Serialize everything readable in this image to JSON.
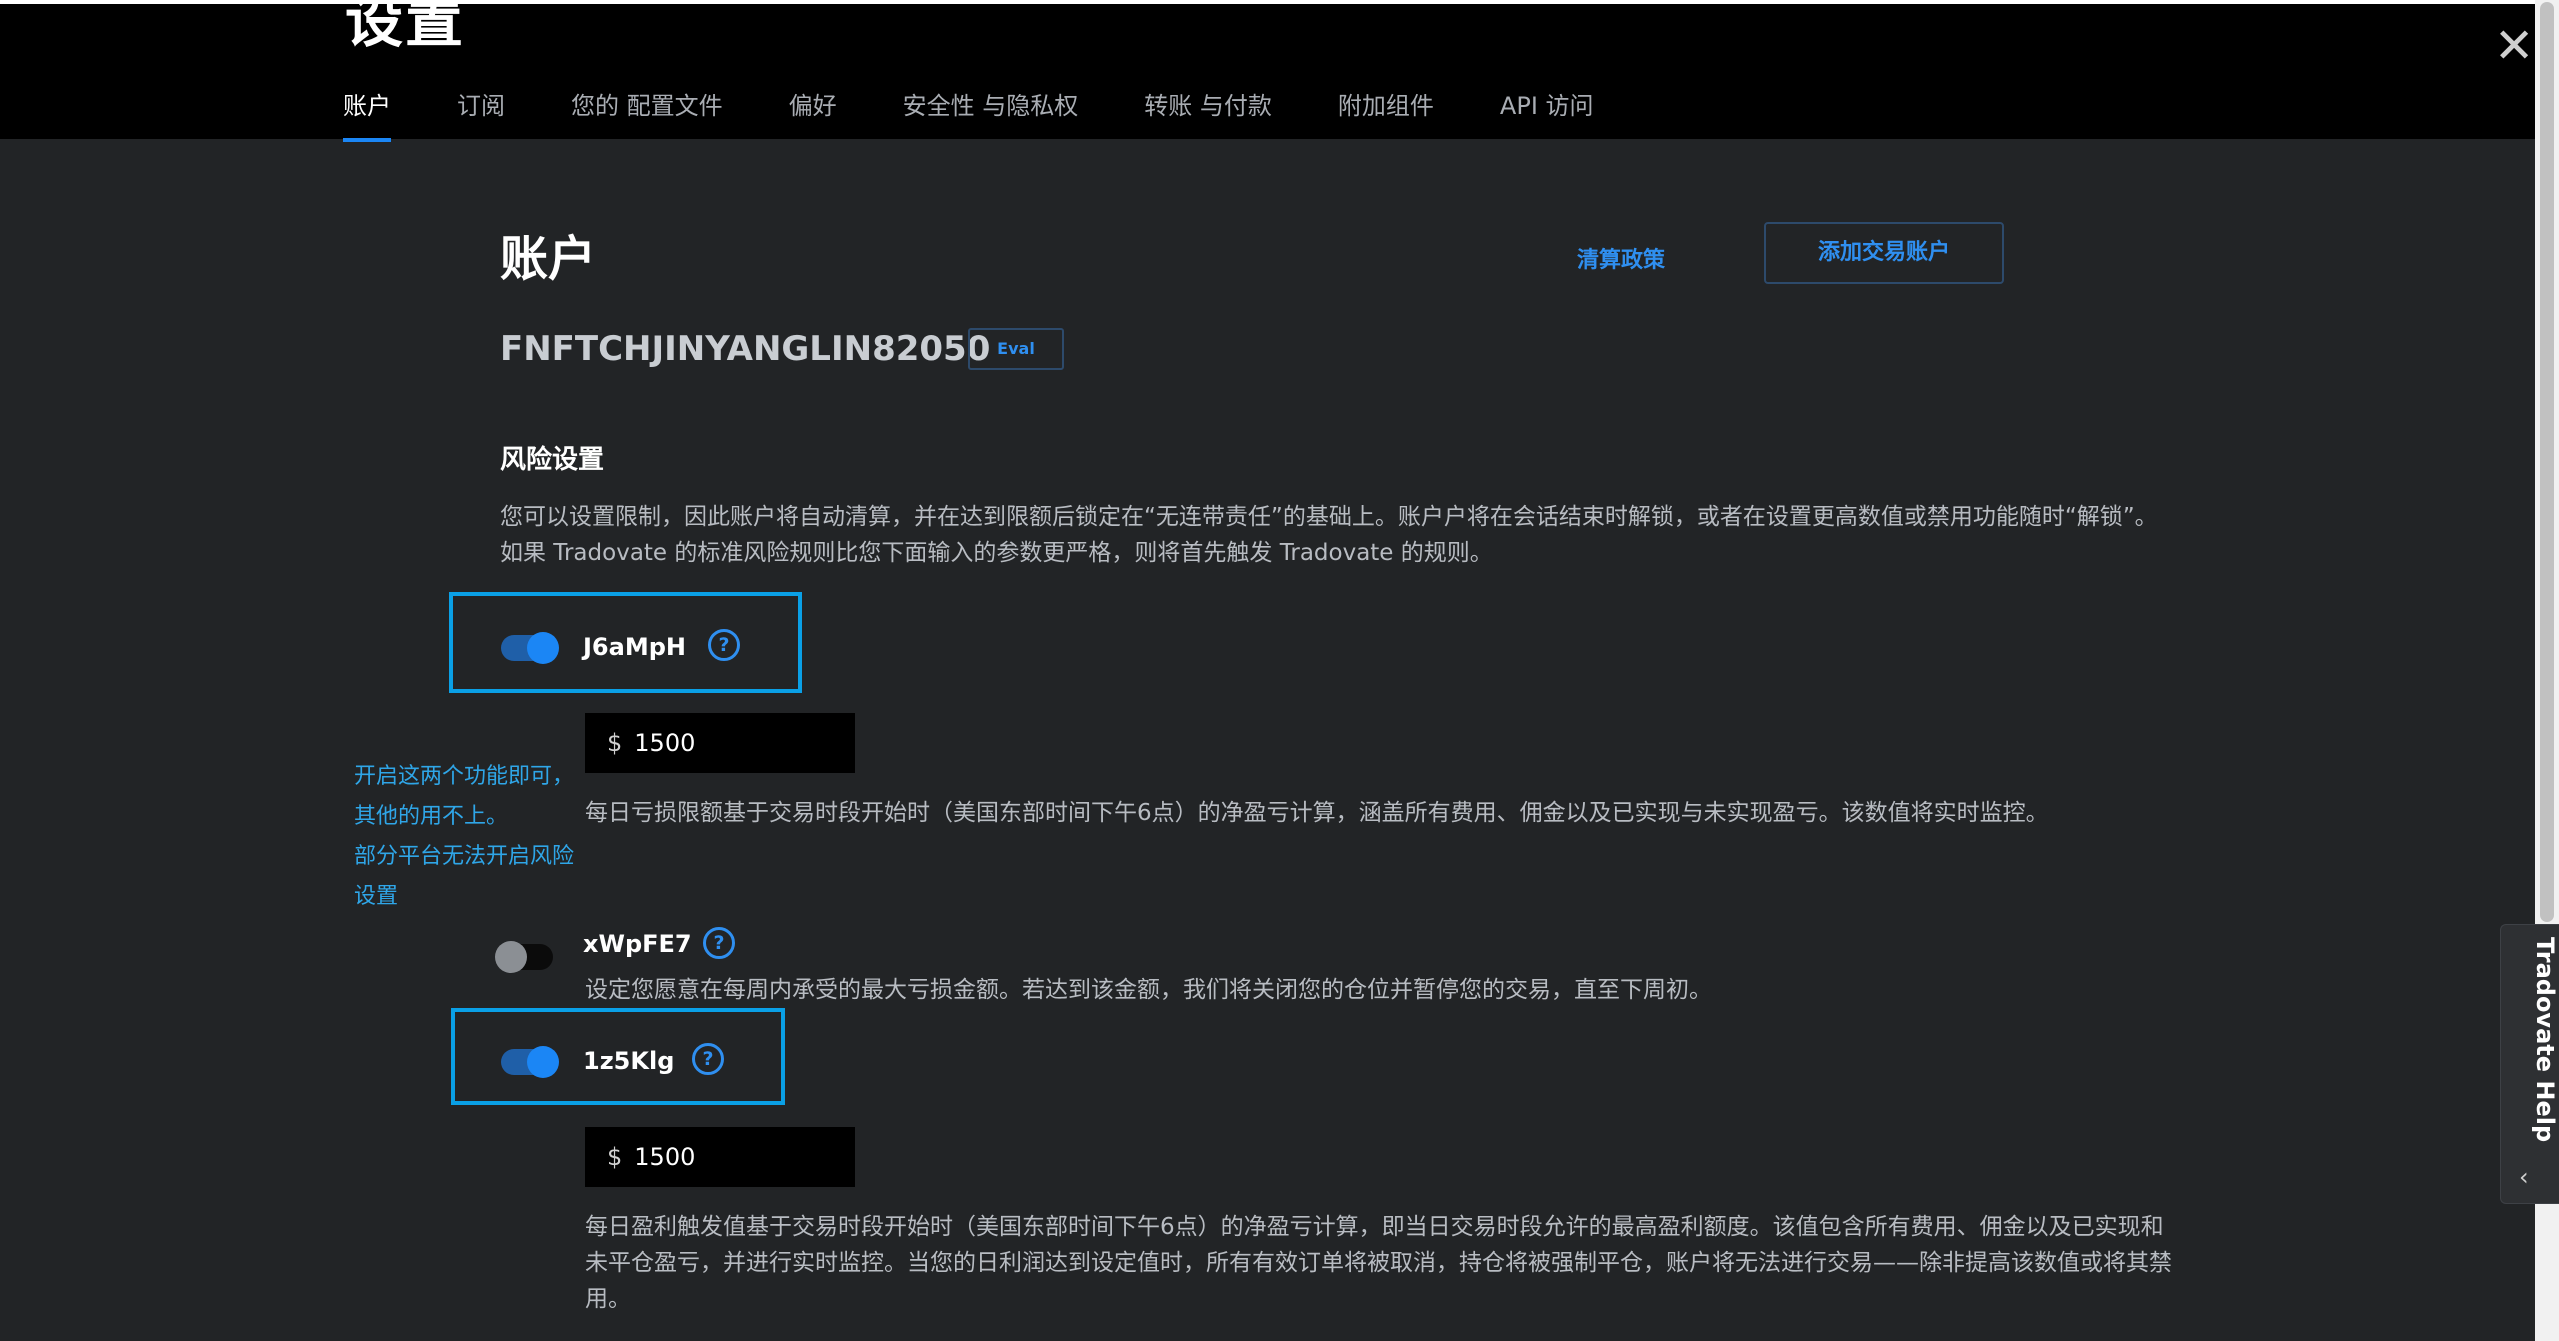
{
  "header": {
    "title": "设置",
    "tabs": [
      {
        "label": "账户",
        "active": true
      },
      {
        "label": "订阅"
      },
      {
        "label": "您的 配置文件"
      },
      {
        "label": "偏好"
      },
      {
        "label": "安全性 与隐私权"
      },
      {
        "label": "转账 与付款"
      },
      {
        "label": "附加组件"
      },
      {
        "label": "API 访问"
      }
    ],
    "close_glyph": "✕"
  },
  "account": {
    "title": "账户",
    "liquidation_policy": "清算政策",
    "add_account_button": "添加交易账户",
    "account_id": "FNFTCHJINYANGLIN82050",
    "badge": "Eval"
  },
  "risk": {
    "title": "风险设置",
    "intro": "您可以设置限制，因此账户将自动清算，并在达到限额后锁定在“无连带责任”的基础上。账户户将在会话结束时解锁，或者在设置更高数值或禁用功能随时“解锁”。如果 Tradovate 的标准风险规则比您下面输入的参数更严格，则将首先触发 Tradovate 的规则。",
    "rules": [
      {
        "label": "J6aMpH",
        "enabled": true,
        "currency": "$",
        "value": "1500",
        "description": "每日亏损限额基于交易时段开始时（美国东部时间下午6点）的净盈亏计算，涵盖所有费用、佣金以及已实现与未实现盈亏。该数值将实时监控。"
      },
      {
        "label": "xWpFE7",
        "enabled": false,
        "description": "设定您愿意在每周内承受的最大亏损金额。若达到该金额，我们将关闭您的仓位并暂停您的交易，直至下周初。"
      },
      {
        "label": "1z5Klg",
        "enabled": true,
        "currency": "$",
        "value": "1500",
        "description": "每日盈利触发值基于交易时段开始时（美国东部时间下午6点）的净盈亏计算，即当日交易时段允许的最高盈利额度。该值包含所有费用、佣金以及已实现和未平仓盈亏，并进行实时监控。当您的日利润达到设定值时，所有有效订单将被取消，持仓将被强制平仓，账户将无法进行交易——除非提高该数值或将其禁用。"
      }
    ],
    "help_glyph": "?"
  },
  "annotation": {
    "lines": [
      "开启这两个功能即可，",
      "其他的用不上。",
      "部分平台无法开启风险",
      "设置"
    ]
  },
  "help_tab": {
    "label": "Tradovate Help",
    "chevron": "‹"
  },
  "colors": {
    "accent": "#1b86f5",
    "highlight": "#0aa0e6",
    "background": "#222426"
  }
}
